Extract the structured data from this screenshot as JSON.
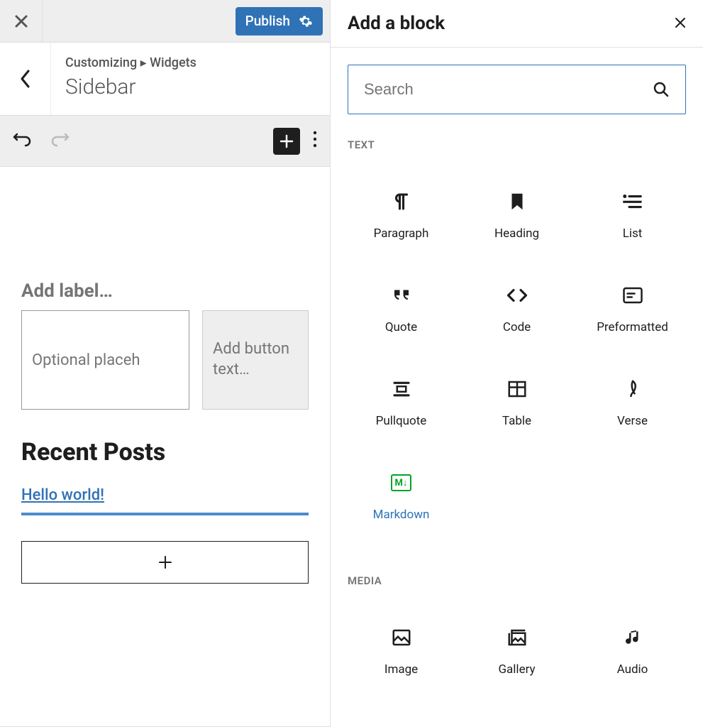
{
  "topbar": {
    "publish_label": "Publish"
  },
  "breadcrumb": {
    "parent": "Customizing",
    "separator": "▸",
    "section": "Widgets",
    "title": "Sidebar"
  },
  "canvas": {
    "add_label_placeholder": "Add label…",
    "search_input_placeholder": "Optional placeh",
    "search_button_placeholder": "Add button text…",
    "recent_heading": "Recent Posts",
    "recent_posts": [
      "Hello world!"
    ]
  },
  "inserter": {
    "title": "Add a block",
    "search_placeholder": "Search",
    "sections": [
      {
        "label": "TEXT",
        "blocks": [
          {
            "id": "paragraph",
            "label": "Paragraph",
            "icon": "pilcrow",
            "selected": false
          },
          {
            "id": "heading",
            "label": "Heading",
            "icon": "bookmark",
            "selected": false
          },
          {
            "id": "list",
            "label": "List",
            "icon": "list",
            "selected": false
          },
          {
            "id": "quote",
            "label": "Quote",
            "icon": "quote",
            "selected": false
          },
          {
            "id": "code",
            "label": "Code",
            "icon": "code",
            "selected": false
          },
          {
            "id": "preformatted",
            "label": "Preformatted",
            "icon": "preformatted",
            "selected": false
          },
          {
            "id": "pullquote",
            "label": "Pullquote",
            "icon": "pullquote",
            "selected": false
          },
          {
            "id": "table",
            "label": "Table",
            "icon": "table",
            "selected": false
          },
          {
            "id": "verse",
            "label": "Verse",
            "icon": "verse",
            "selected": false
          },
          {
            "id": "markdown",
            "label": "Markdown",
            "icon": "markdown",
            "selected": true
          }
        ]
      },
      {
        "label": "MEDIA",
        "blocks": [
          {
            "id": "image",
            "label": "Image",
            "icon": "image",
            "selected": false
          },
          {
            "id": "gallery",
            "label": "Gallery",
            "icon": "gallery",
            "selected": false
          },
          {
            "id": "audio",
            "label": "Audio",
            "icon": "audio",
            "selected": false
          }
        ]
      }
    ]
  }
}
